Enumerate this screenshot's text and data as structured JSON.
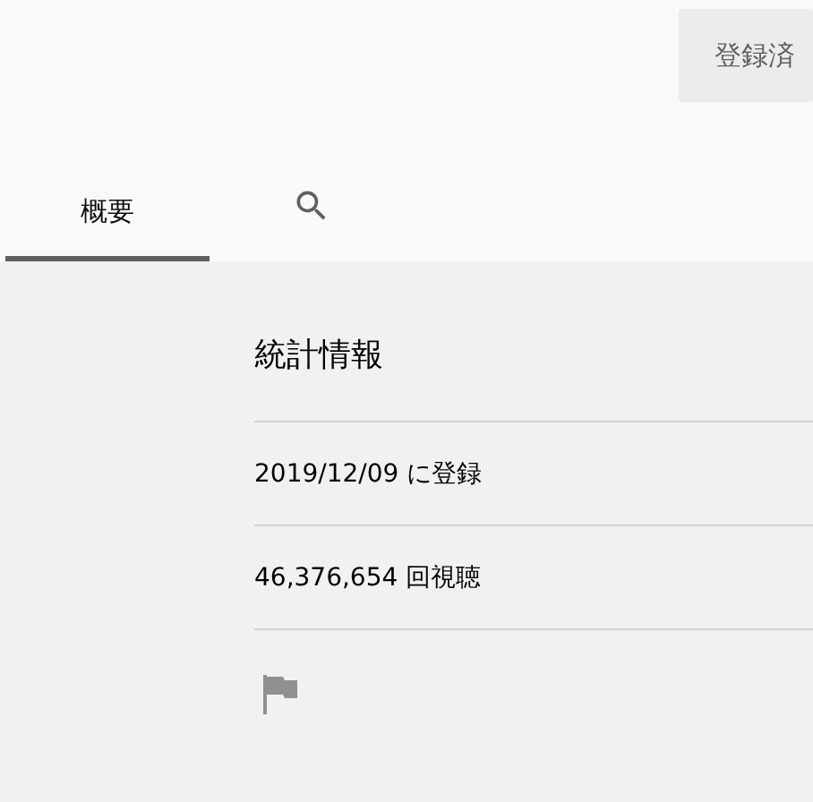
{
  "header": {
    "subscribe_button": {
      "label": "登録済",
      "subscribed": true
    }
  },
  "tabs": [
    {
      "kind": "text",
      "label": "概要",
      "selected": true
    },
    {
      "kind": "search",
      "selected": false
    }
  ],
  "stats": {
    "title": "統計情報",
    "rows": [
      "2019/12/09 に登録",
      "46,376,654 回視聴"
    ]
  }
}
